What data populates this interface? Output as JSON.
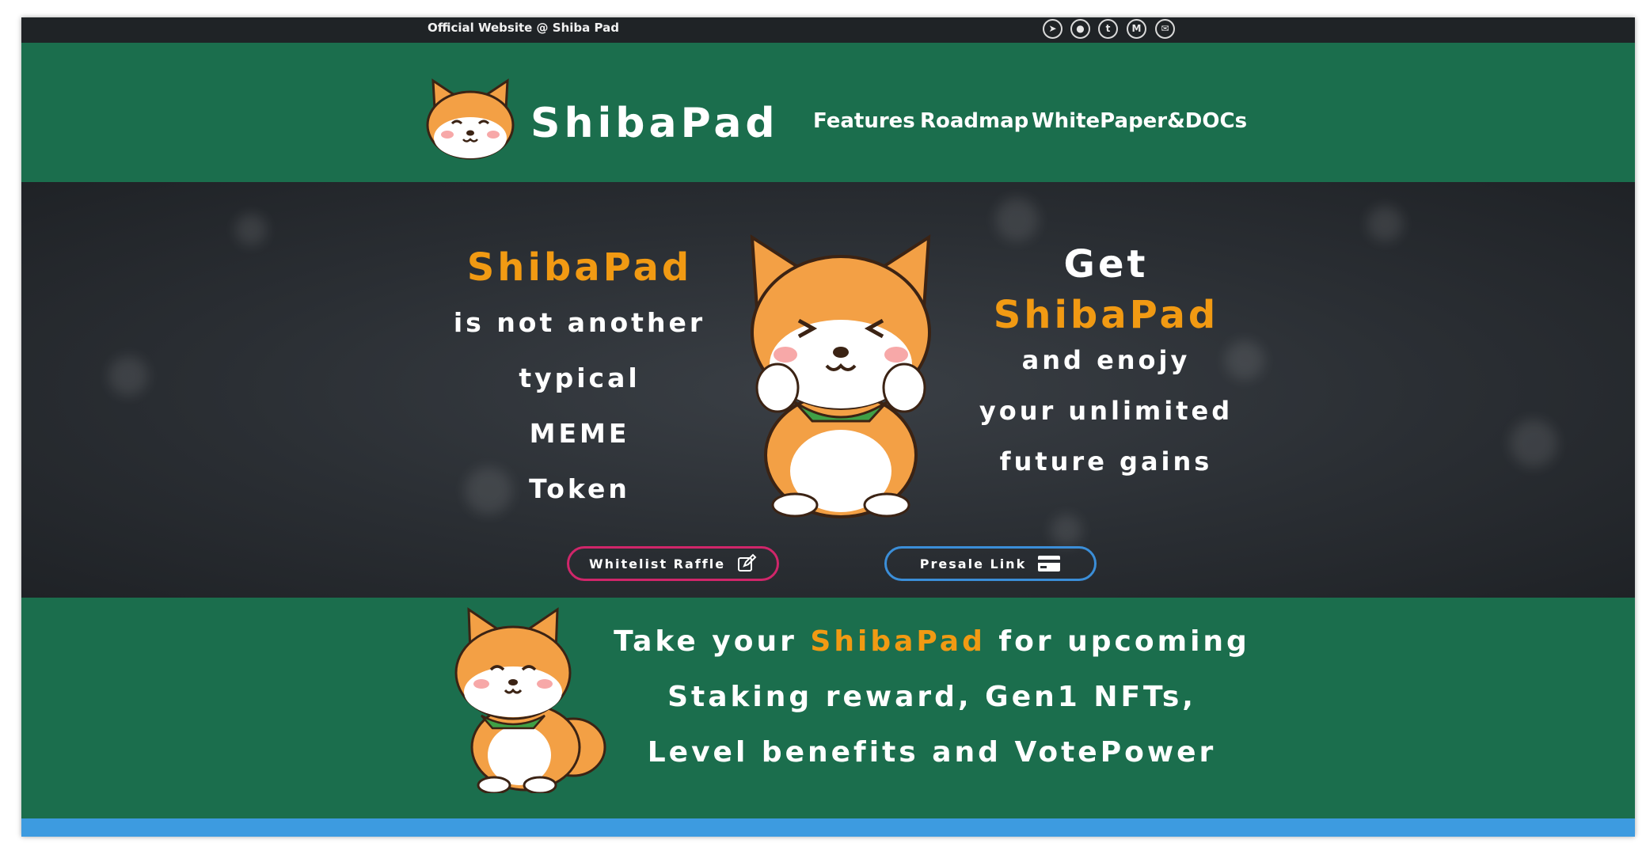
{
  "topbar": {
    "text": "Official Website @ Shiba Pad",
    "social_icons": [
      "telegram-icon",
      "github-icon",
      "twitter-icon",
      "medium-icon",
      "email-icon"
    ]
  },
  "header": {
    "logo_text": "ShibaPad",
    "nav": [
      "Features",
      "Roadmap",
      "WhitePaper&DOCs"
    ]
  },
  "hero": {
    "left_lines": [
      "ShibaPad",
      "is not another",
      "typical",
      "MEME",
      "Token"
    ],
    "right_lines": [
      "Get",
      "ShibaPad",
      "and enojy",
      "your unlimited",
      "future gains"
    ],
    "whitelist_button": "Whitelist Raffle",
    "presale_button": "Presale Link"
  },
  "promo": {
    "line1_prefix": "Take your",
    "line1_highlight": "ShibaPad",
    "line1_suffix": "for upcoming",
    "line2": "Staking reward, Gen1 NFTs,",
    "line3": "Level benefits and VotePower"
  },
  "colors": {
    "green": "#1b6e4d",
    "orange": "#f19a13",
    "dark": "#1f2326",
    "pink": "#d0266a",
    "blue": "#3b8ed8"
  }
}
